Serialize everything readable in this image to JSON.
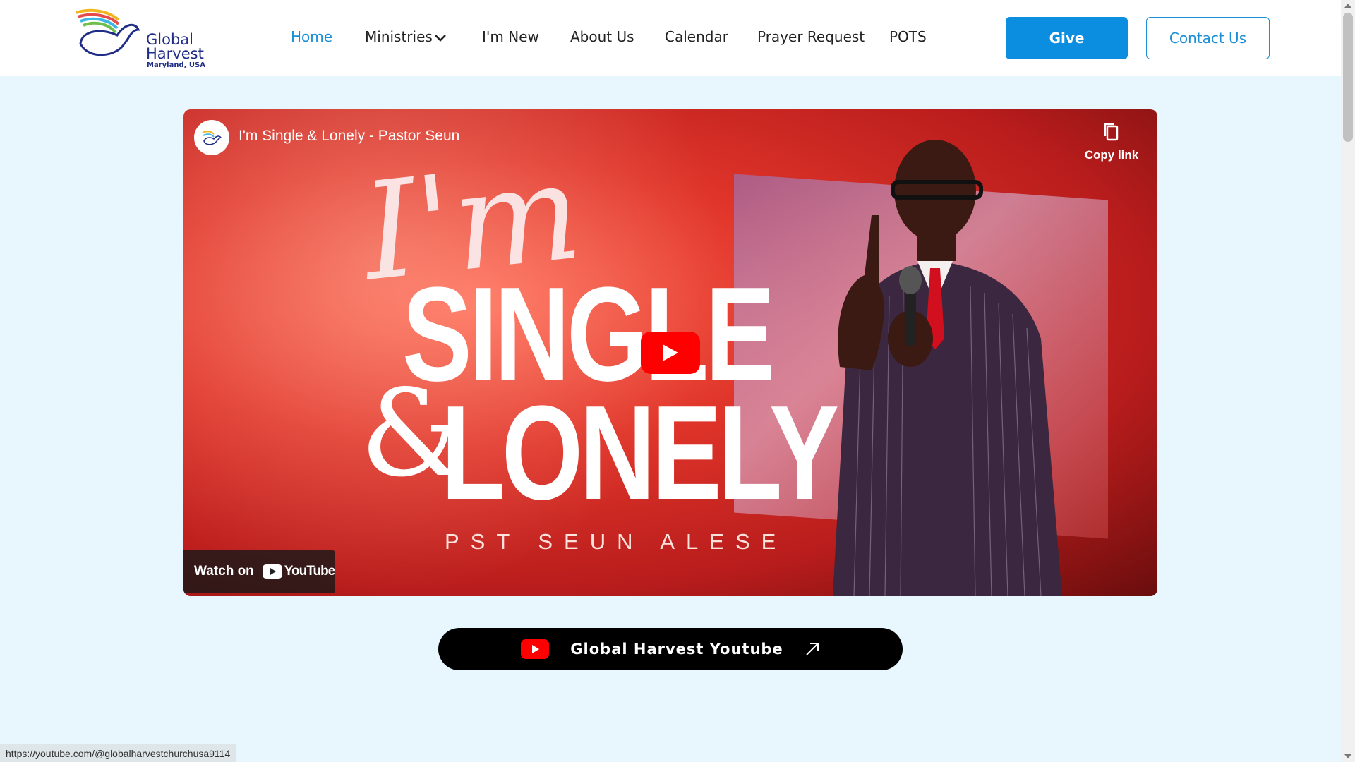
{
  "header": {
    "logo": {
      "line1": "Global",
      "line2": "Harvest",
      "line3": "Maryland, USA"
    },
    "nav": [
      {
        "label": "Home",
        "active": true
      },
      {
        "label": "Ministries",
        "has_dropdown": true
      },
      {
        "label": "I'm New"
      },
      {
        "label": "About Us"
      },
      {
        "label": "Calendar"
      },
      {
        "label": "Prayer Request"
      },
      {
        "label": "POTS"
      }
    ],
    "give_label": "Give",
    "contact_label": "Contact Us"
  },
  "video": {
    "title": "I'm Single & Lonely - Pastor Seun",
    "copy_link_label": "Copy link",
    "thumbnail": {
      "line_im": "I'm",
      "line_single": "SINGLE",
      "ampersand": "&",
      "line_lonely": "LONELY",
      "pastor": "PST SEUN ALESE"
    },
    "watch_on_label": "Watch on",
    "youtube_wordmark": "YouTube"
  },
  "youtube_button": {
    "label": "Global Harvest Youtube"
  },
  "status_url": "https://youtube.com/@globalharvestchurchusa9114",
  "colors": {
    "accent": "#1a8fd6",
    "give_bg": "#0b8de0",
    "page_bg": "#e8f7fd",
    "youtube_red": "#ff0000"
  }
}
